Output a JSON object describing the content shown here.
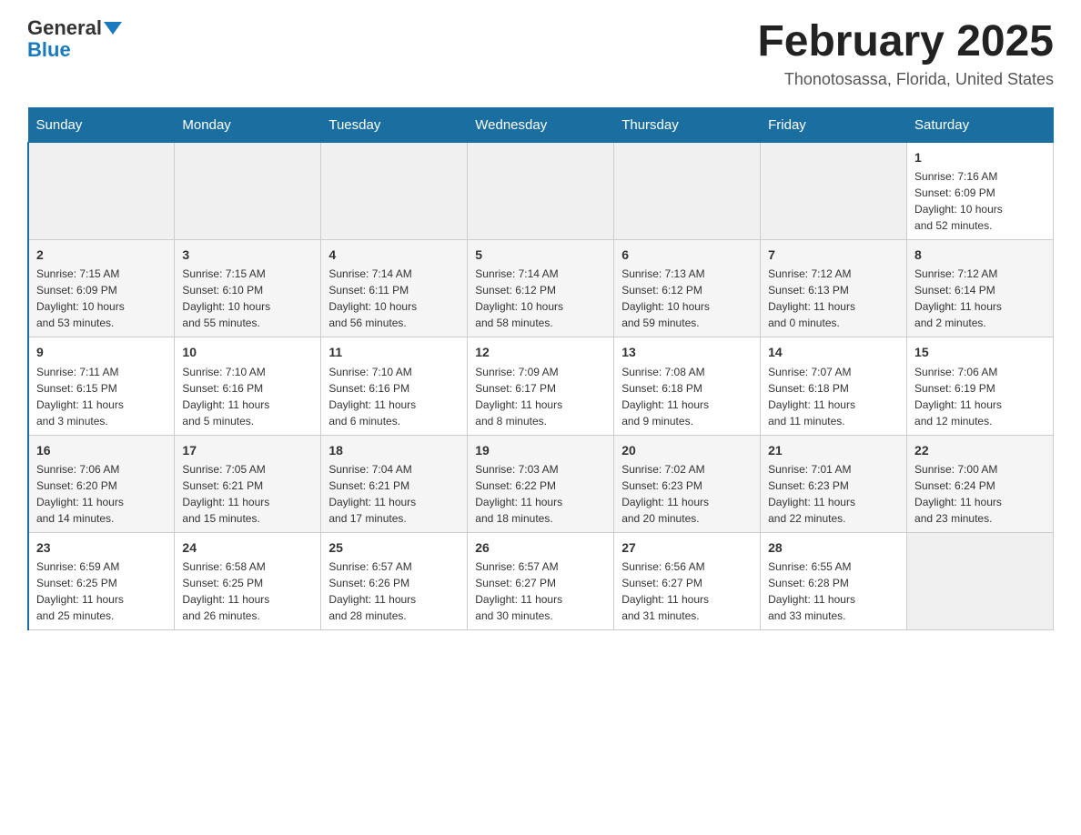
{
  "header": {
    "logo_general": "General",
    "logo_blue": "Blue",
    "month_title": "February 2025",
    "subtitle": "Thonotosassa, Florida, United States"
  },
  "days_of_week": [
    "Sunday",
    "Monday",
    "Tuesday",
    "Wednesday",
    "Thursday",
    "Friday",
    "Saturday"
  ],
  "weeks": [
    [
      {
        "day": "",
        "info": ""
      },
      {
        "day": "",
        "info": ""
      },
      {
        "day": "",
        "info": ""
      },
      {
        "day": "",
        "info": ""
      },
      {
        "day": "",
        "info": ""
      },
      {
        "day": "",
        "info": ""
      },
      {
        "day": "1",
        "info": "Sunrise: 7:16 AM\nSunset: 6:09 PM\nDaylight: 10 hours\nand 52 minutes."
      }
    ],
    [
      {
        "day": "2",
        "info": "Sunrise: 7:15 AM\nSunset: 6:09 PM\nDaylight: 10 hours\nand 53 minutes."
      },
      {
        "day": "3",
        "info": "Sunrise: 7:15 AM\nSunset: 6:10 PM\nDaylight: 10 hours\nand 55 minutes."
      },
      {
        "day": "4",
        "info": "Sunrise: 7:14 AM\nSunset: 6:11 PM\nDaylight: 10 hours\nand 56 minutes."
      },
      {
        "day": "5",
        "info": "Sunrise: 7:14 AM\nSunset: 6:12 PM\nDaylight: 10 hours\nand 58 minutes."
      },
      {
        "day": "6",
        "info": "Sunrise: 7:13 AM\nSunset: 6:12 PM\nDaylight: 10 hours\nand 59 minutes."
      },
      {
        "day": "7",
        "info": "Sunrise: 7:12 AM\nSunset: 6:13 PM\nDaylight: 11 hours\nand 0 minutes."
      },
      {
        "day": "8",
        "info": "Sunrise: 7:12 AM\nSunset: 6:14 PM\nDaylight: 11 hours\nand 2 minutes."
      }
    ],
    [
      {
        "day": "9",
        "info": "Sunrise: 7:11 AM\nSunset: 6:15 PM\nDaylight: 11 hours\nand 3 minutes."
      },
      {
        "day": "10",
        "info": "Sunrise: 7:10 AM\nSunset: 6:16 PM\nDaylight: 11 hours\nand 5 minutes."
      },
      {
        "day": "11",
        "info": "Sunrise: 7:10 AM\nSunset: 6:16 PM\nDaylight: 11 hours\nand 6 minutes."
      },
      {
        "day": "12",
        "info": "Sunrise: 7:09 AM\nSunset: 6:17 PM\nDaylight: 11 hours\nand 8 minutes."
      },
      {
        "day": "13",
        "info": "Sunrise: 7:08 AM\nSunset: 6:18 PM\nDaylight: 11 hours\nand 9 minutes."
      },
      {
        "day": "14",
        "info": "Sunrise: 7:07 AM\nSunset: 6:18 PM\nDaylight: 11 hours\nand 11 minutes."
      },
      {
        "day": "15",
        "info": "Sunrise: 7:06 AM\nSunset: 6:19 PM\nDaylight: 11 hours\nand 12 minutes."
      }
    ],
    [
      {
        "day": "16",
        "info": "Sunrise: 7:06 AM\nSunset: 6:20 PM\nDaylight: 11 hours\nand 14 minutes."
      },
      {
        "day": "17",
        "info": "Sunrise: 7:05 AM\nSunset: 6:21 PM\nDaylight: 11 hours\nand 15 minutes."
      },
      {
        "day": "18",
        "info": "Sunrise: 7:04 AM\nSunset: 6:21 PM\nDaylight: 11 hours\nand 17 minutes."
      },
      {
        "day": "19",
        "info": "Sunrise: 7:03 AM\nSunset: 6:22 PM\nDaylight: 11 hours\nand 18 minutes."
      },
      {
        "day": "20",
        "info": "Sunrise: 7:02 AM\nSunset: 6:23 PM\nDaylight: 11 hours\nand 20 minutes."
      },
      {
        "day": "21",
        "info": "Sunrise: 7:01 AM\nSunset: 6:23 PM\nDaylight: 11 hours\nand 22 minutes."
      },
      {
        "day": "22",
        "info": "Sunrise: 7:00 AM\nSunset: 6:24 PM\nDaylight: 11 hours\nand 23 minutes."
      }
    ],
    [
      {
        "day": "23",
        "info": "Sunrise: 6:59 AM\nSunset: 6:25 PM\nDaylight: 11 hours\nand 25 minutes."
      },
      {
        "day": "24",
        "info": "Sunrise: 6:58 AM\nSunset: 6:25 PM\nDaylight: 11 hours\nand 26 minutes."
      },
      {
        "day": "25",
        "info": "Sunrise: 6:57 AM\nSunset: 6:26 PM\nDaylight: 11 hours\nand 28 minutes."
      },
      {
        "day": "26",
        "info": "Sunrise: 6:57 AM\nSunset: 6:27 PM\nDaylight: 11 hours\nand 30 minutes."
      },
      {
        "day": "27",
        "info": "Sunrise: 6:56 AM\nSunset: 6:27 PM\nDaylight: 11 hours\nand 31 minutes."
      },
      {
        "day": "28",
        "info": "Sunrise: 6:55 AM\nSunset: 6:28 PM\nDaylight: 11 hours\nand 33 minutes."
      },
      {
        "day": "",
        "info": ""
      }
    ]
  ]
}
